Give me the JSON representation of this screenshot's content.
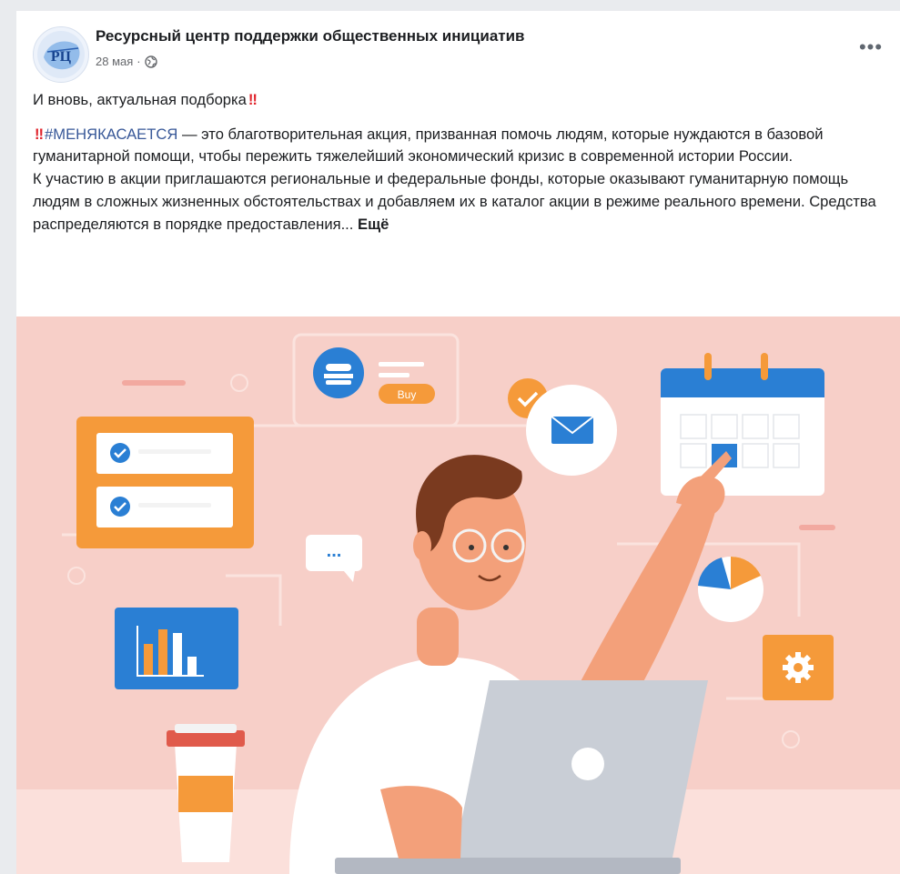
{
  "post": {
    "page_name": "Ресурсный центр поддержки общественных инициатив",
    "avatar_text": "РЦ",
    "date": "28 мая",
    "separator": " · ",
    "privacy_icon": "globe-icon",
    "more_icon": "more-horizontal-icon",
    "text": {
      "line1": "И вновь, актуальная подборка",
      "emoji": "‼",
      "hashtag": "#МЕНЯКАСАЕТСЯ",
      "para1_rest": " — это благотворительная акция, призванная помочь людям, которые нуждаются в базовой гуманитарной помощи, чтобы пережить тяжелейший экономический кризис в современной истории России.",
      "para2": "К участию в акции приглашаются региональные и федеральные фонды, которые оказывают гуманитарную помощь людям в сложных жизненных обстоятельствах и добавляем их в каталог акции в режиме реального времени. Средства распределяются в порядке предоставления...",
      "more_label": " Ещё"
    }
  },
  "illustration": {
    "buy_label": "Buy",
    "dots_label": "...",
    "colors": {
      "background": "#f7cfc8",
      "orange": "#f59a3a",
      "blue": "#2a7fd4",
      "white": "#ffffff",
      "grey": "#c9ced6"
    }
  }
}
